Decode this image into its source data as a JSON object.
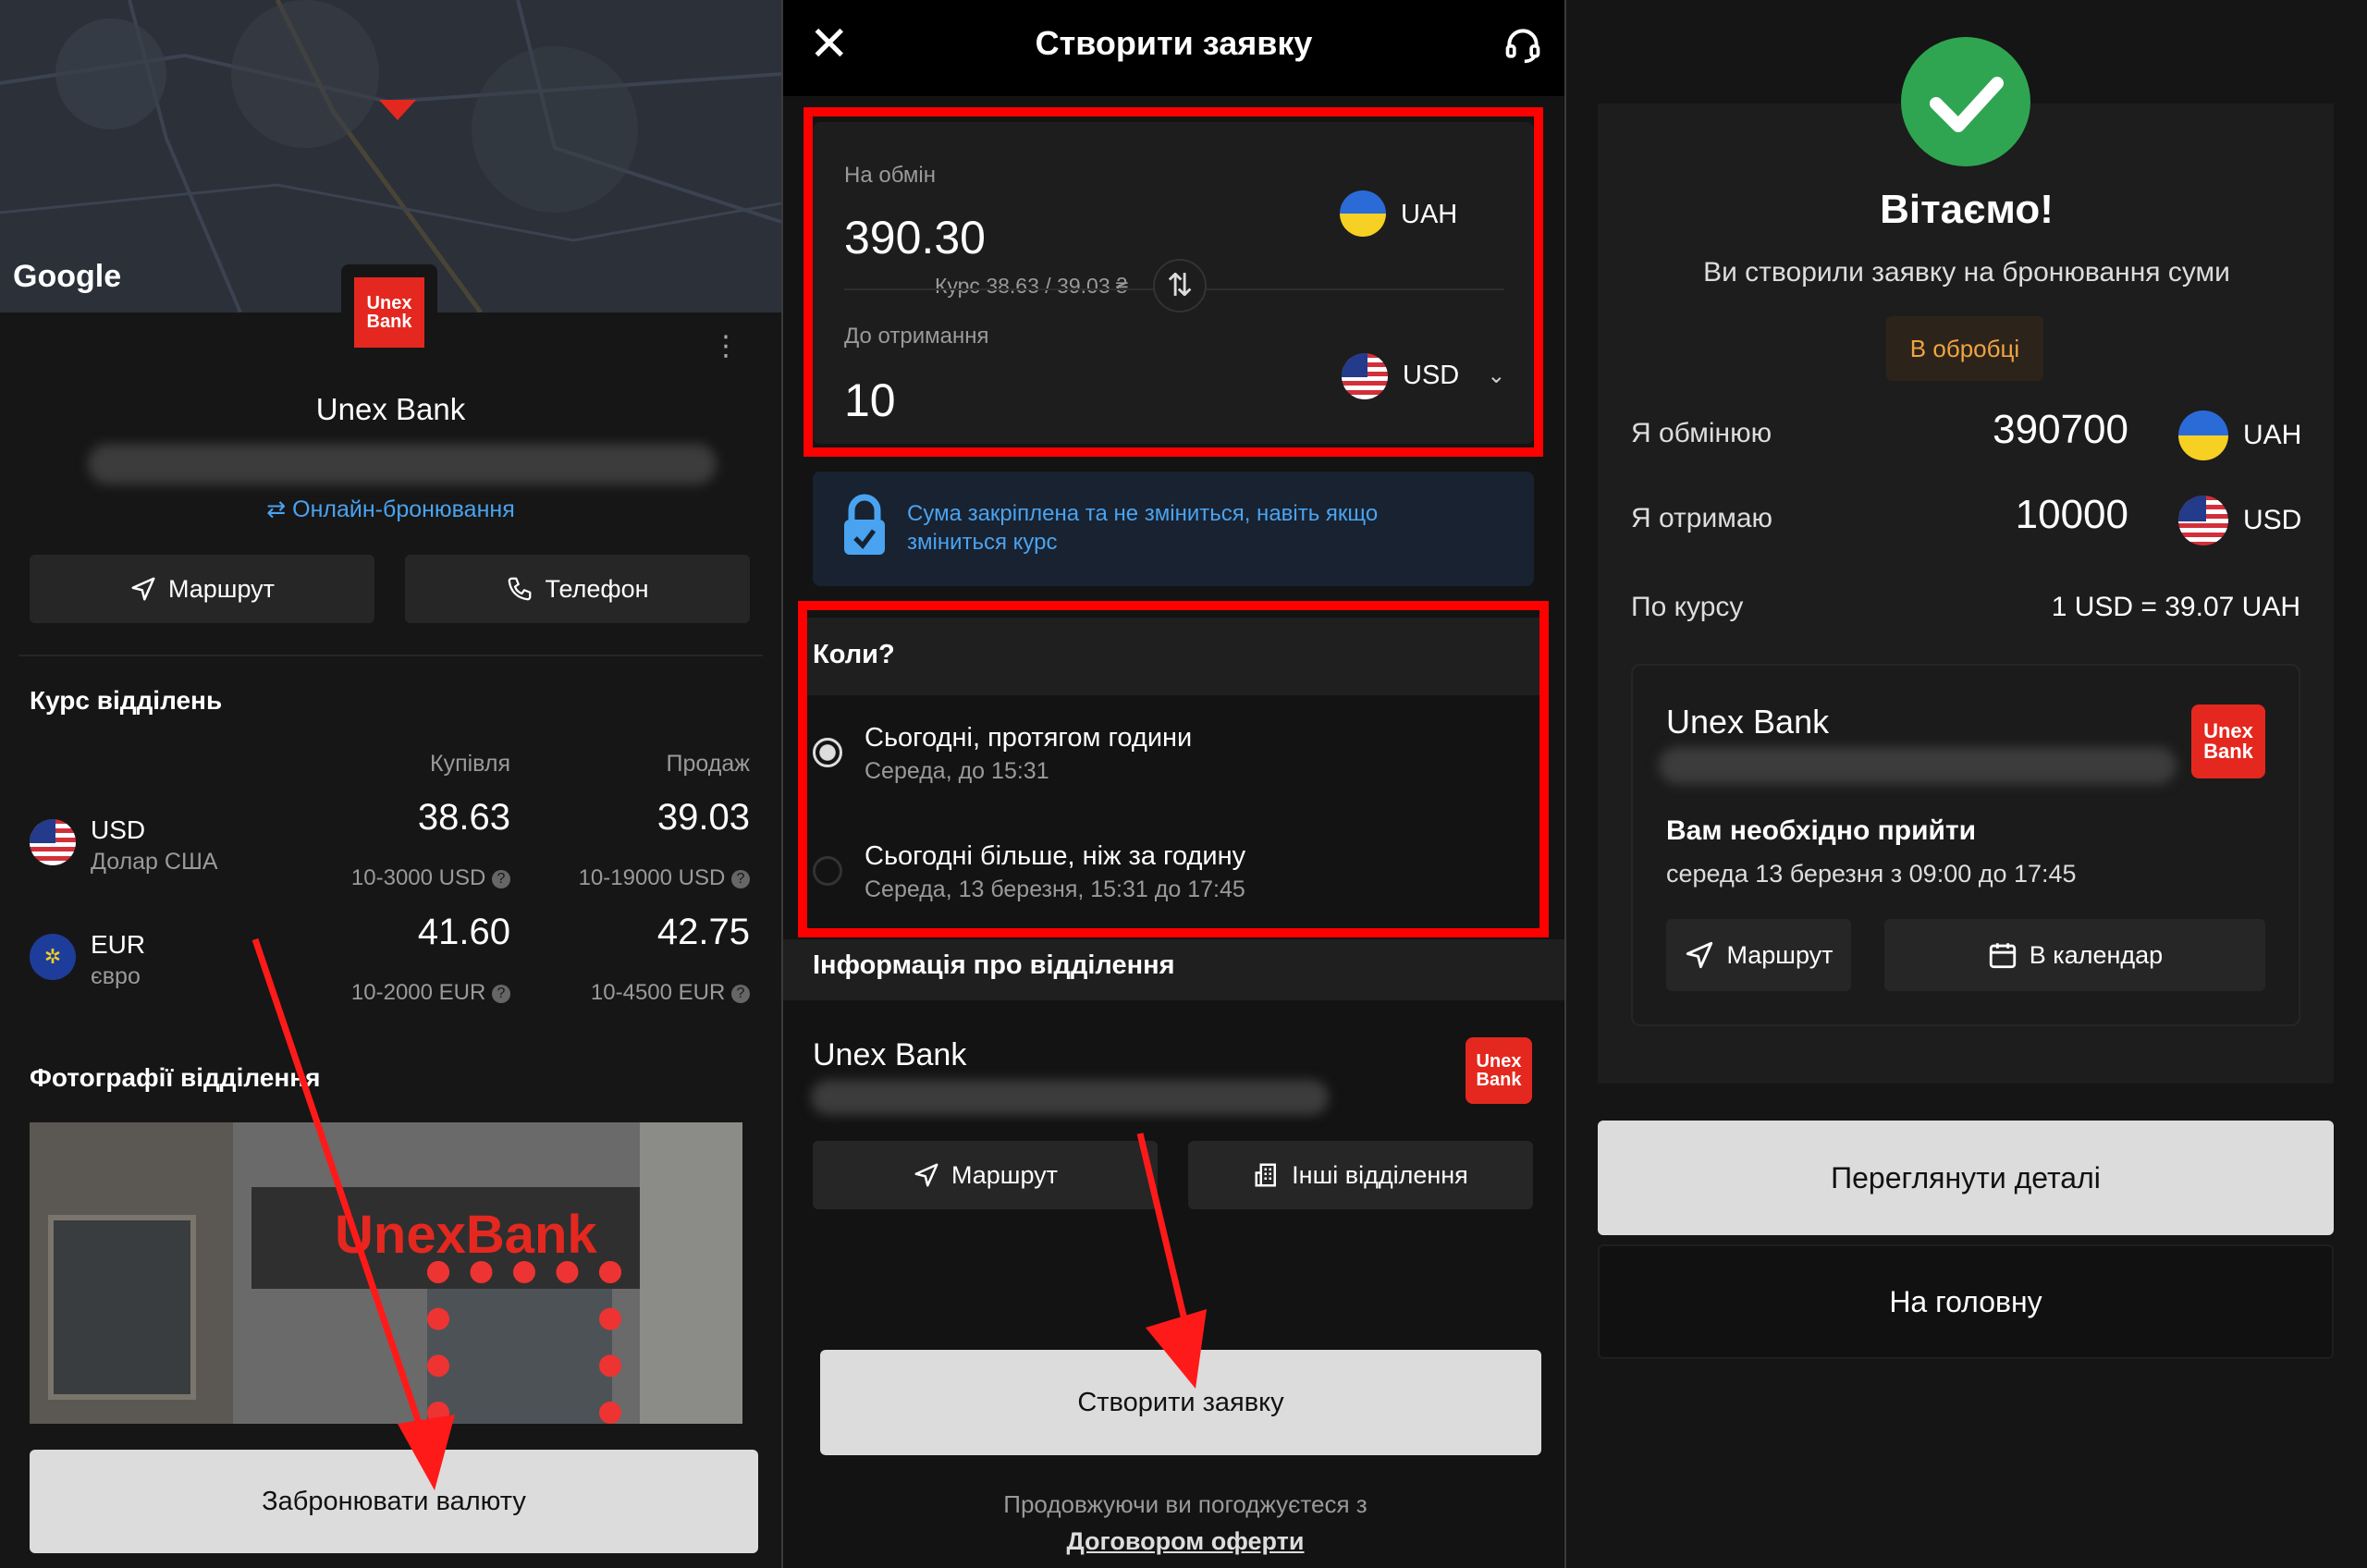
{
  "colors": {
    "accent_red": "#e4281f",
    "link_blue": "#4aa3f0",
    "success_green": "#2fa552",
    "badge_orange": "#f0a443",
    "highlight_red": "#ff0000"
  },
  "screen1": {
    "map_label": "Google",
    "logo": {
      "line1": "Unex",
      "line2": "Bank"
    },
    "bank_name": "Unex Bank",
    "online_booking": "Онлайн-бронювання",
    "route_btn": "Маршрут",
    "phone_btn": "Телефон",
    "rates_title": "Курс відділень",
    "col_buy": "Купівля",
    "col_sell": "Продаж",
    "rates": [
      {
        "code": "USD",
        "name": "Долар США",
        "buy": "38.63",
        "sell": "39.03",
        "buy_limit": "10-3000 USD",
        "sell_limit": "10-19000 USD",
        "flag": "us-flag-icon"
      },
      {
        "code": "EUR",
        "name": "євро",
        "buy": "41.60",
        "sell": "42.75",
        "buy_limit": "10-2000 EUR",
        "sell_limit": "10-4500 EUR",
        "flag": "eu-flag-icon"
      }
    ],
    "photos_title": "Фотографії відділення",
    "photo_sign": "UnexBank",
    "book_btn": "Забронювати валюту"
  },
  "screen2": {
    "title": "Створити заявку",
    "exchange_label": "На обмін",
    "exchange_value": "390.30",
    "exchange_currency": "UAH",
    "rate_text": "Курс 38.63 / 39.03 ₴",
    "receive_label": "До отримання",
    "receive_value": "10",
    "receive_currency": "USD",
    "lock_note": "Сума закріплена та не зміниться, навіть якщо зміниться курс",
    "when_title": "Коли?",
    "options": [
      {
        "title": "Сьогодні, протягом години",
        "sub": "Середа, до 15:31",
        "selected": true
      },
      {
        "title": "Сьогодні більше, ніж за годину",
        "sub": "Середа, 13 березня, 15:31 до 17:45",
        "selected": false
      }
    ],
    "branch_info_title": "Інформація про відділення",
    "bank_name": "Unex Bank",
    "logo": {
      "line1": "Unex",
      "line2": "Bank"
    },
    "route_btn": "Маршрут",
    "other_btn": "Інші відділення",
    "create_btn": "Створити заявку",
    "agree_text": "Продовжуючи ви погоджуєтеся з",
    "offer_link": "Договором оферти"
  },
  "screen3": {
    "title": "Вітаємо!",
    "subtitle": "Ви створили заявку на бронювання суми",
    "status": "В обробці",
    "exchange_label": "Я обмінюю",
    "exchange_value": "390700",
    "exchange_currency": "UAH",
    "receive_label": "Я отримаю",
    "receive_value": "10000",
    "receive_currency": "USD",
    "rate_label": "По курсу",
    "rate_value": "1 USD = 39.07 UAH",
    "bank_name": "Unex Bank",
    "logo": {
      "line1": "Unex",
      "line2": "Bank"
    },
    "need_title": "Вам необхідно прийти",
    "need_time": "середа 13 березня з 09:00 до 17:45",
    "route_btn": "Маршрут",
    "calendar_btn": "В календар",
    "details_btn": "Переглянути деталі",
    "home_btn": "На головну"
  }
}
